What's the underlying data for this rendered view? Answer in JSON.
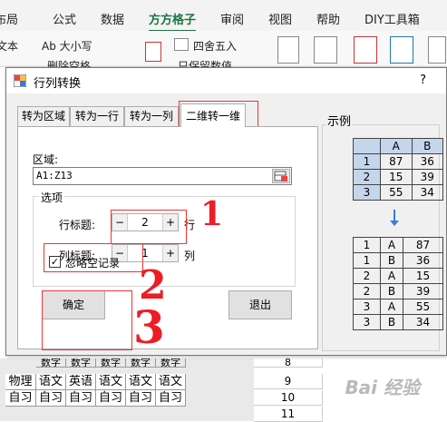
{
  "ribbon": {
    "tabs": [
      "布局",
      "公式",
      "数据",
      "方方格子",
      "审阅",
      "视图",
      "帮助",
      "DIY工具箱"
    ],
    "active_tab": "方方格子",
    "items": [
      "文本",
      "Ab 大小写",
      "删除空格",
      "四舍五入",
      "只保留数值"
    ]
  },
  "dialog": {
    "title": "行列转换",
    "help": "?",
    "tabs": [
      "转为区域",
      "转为一行",
      "转为一列",
      "二维转一维"
    ],
    "active_tab_index": 3,
    "range_label": "区域:",
    "range_value": "A1:Z13",
    "options_legend": "选项",
    "row_header_label": "行标题:",
    "row_header_value": "2",
    "row_unit": "行",
    "col_header_label": "列标题:",
    "col_header_value": "1",
    "col_unit": "列",
    "ignore_empty_label": "忽略空记录",
    "ignore_empty_checked": true,
    "ok_label": "确定",
    "exit_label": "退出",
    "minus": "−",
    "plus": "+"
  },
  "example": {
    "title": "示例",
    "table1": {
      "header": [
        "",
        "A",
        "B"
      ],
      "rows": [
        [
          "1",
          "87",
          "36"
        ],
        [
          "2",
          "15",
          "39"
        ],
        [
          "3",
          "55",
          "34"
        ]
      ]
    },
    "table2": {
      "rows": [
        [
          "1",
          "A",
          "87"
        ],
        [
          "1",
          "B",
          "36"
        ],
        [
          "2",
          "A",
          "15"
        ],
        [
          "2",
          "B",
          "39"
        ],
        [
          "3",
          "A",
          "55"
        ],
        [
          "3",
          "B",
          "34"
        ]
      ]
    }
  },
  "annotations": [
    "1",
    "2",
    "3"
  ],
  "sheet": {
    "row_a": [
      "物理",
      "语文",
      "英语",
      "语文",
      "语文",
      "语文"
    ],
    "row_b": [
      "自习",
      "自习",
      "自习",
      "自习",
      "自习",
      "自习"
    ],
    "row_top_partial": [
      "数字",
      "数字",
      "数字",
      "数字",
      "数字"
    ],
    "row_numbers": [
      "8",
      "9",
      "10",
      "11"
    ]
  },
  "watermark": "Bai 经验",
  "colors": {
    "accent": "#217346",
    "annotation": "#ee1c25",
    "example_header": "#c5d6ec"
  }
}
